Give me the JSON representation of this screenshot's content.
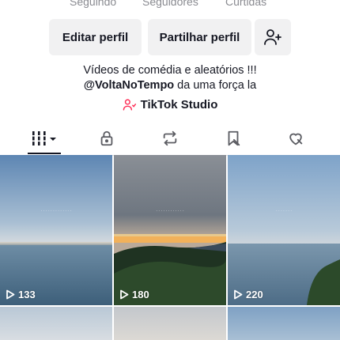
{
  "stats": {
    "following_label": "Seguindo",
    "followers_label": "Seguidores",
    "likes_label": "Curtidas"
  },
  "actions": {
    "edit_profile": "Editar perfil",
    "share_profile": "Partilhar perfil",
    "add_friend_icon": "add-user-icon"
  },
  "bio": {
    "line1": "Vídeos de comédia e aleatórios !!!",
    "mention": "@VoltaNoTempo",
    "line2_rest": " da uma força la"
  },
  "studio": {
    "label": "TikTok Studio",
    "icon": "studio-user-icon"
  },
  "tabs": [
    {
      "name": "videos",
      "icon": "grid-dropdown-icon",
      "active": true
    },
    {
      "name": "private",
      "icon": "lock-icon"
    },
    {
      "name": "reposts",
      "icon": "repost-icon"
    },
    {
      "name": "favorites",
      "icon": "bookmark-icon"
    },
    {
      "name": "liked",
      "icon": "heart-icon"
    }
  ],
  "videos": [
    {
      "views": "133"
    },
    {
      "views": "180"
    },
    {
      "views": "220"
    }
  ],
  "colors": {
    "accent": "#fe2c55",
    "text": "#161823",
    "muted": "#8a8b91",
    "button_bg": "#f1f1f2"
  }
}
